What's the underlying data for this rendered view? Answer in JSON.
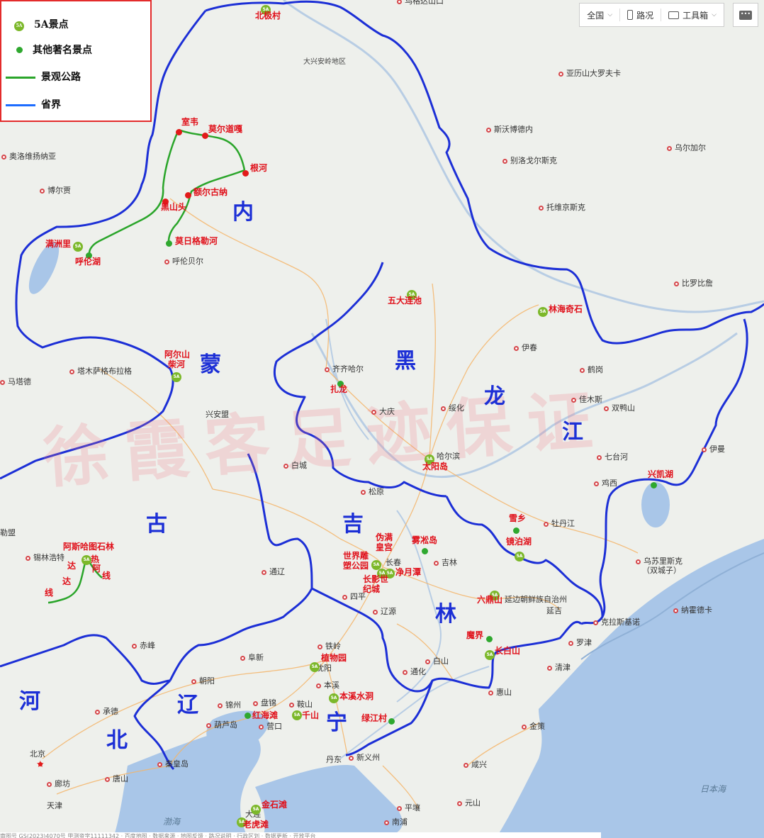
{
  "legend": {
    "items": [
      {
        "label": "5A景点",
        "symbol": "5A"
      },
      {
        "label": "其他著名景点",
        "symbol": "green-dot"
      },
      {
        "label": "景观公路",
        "symbol": "green-line"
      },
      {
        "label": "省界",
        "symbol": "blue-line"
      }
    ],
    "badge_text": "5A"
  },
  "toolbar": {
    "scope": "全国",
    "traffic": "路况",
    "tools": "工具箱"
  },
  "colors": {
    "province_border": "#1c2fd6",
    "scenic_road": "#2aa52a",
    "scenic_text": "#e0101a",
    "sea": "#a9c6e8",
    "land": "#eef0ec"
  },
  "provinces": {
    "nei": "内",
    "meng": "蒙",
    "gu": "古",
    "hei": "黑",
    "long": "龙",
    "jiang": "江",
    "ji": "吉",
    "lin": "林",
    "liao": "辽",
    "ning": "宁",
    "he": "河",
    "bei": "北"
  },
  "scenic": {
    "beijicun": "北极村",
    "shiwei": "室韦",
    "moerdaoga": "莫尔道嘎",
    "genhe": "根河",
    "eerguna": "额尔古纳",
    "heishantou": "黑山头",
    "mangzhouli": "满洲里",
    "hulunhu": "呼伦湖",
    "morigele": "莫日格勒河",
    "wudalianchi": "五大连池",
    "linhaiqishi": "林海奇石",
    "aershan": "阿尔山",
    "chaihe": "柴河",
    "zhalong": "扎龙",
    "taiyangdao": "太阳岛",
    "xingkaihu": "兴凯湖",
    "xuexiang": "雪乡",
    "jingpohu": "镜泊湖",
    "asihatu": "阿斯哈图石林",
    "daretai_1": "达",
    "daretai_2": "热",
    "daretai_3": "阿",
    "daretai_4": "线",
    "daretai_5": "达",
    "daretai_6": "线",
    "weimanhuanggong": "伪满皇宫",
    "shijiediaosu": "世界雕塑公园",
    "changying": "长影世纪城",
    "jingyuetan": "净月潭",
    "wusongdao": "雾凇岛",
    "liudingshan": "六鼎山",
    "mojie": "魔界",
    "changbaishan": "长白山",
    "zhiwuyuan": "植物园",
    "benxishuidong": "本溪水洞",
    "lvjiangcun": "绿江村",
    "honghaitan": "红海滩",
    "qianshan": "千山",
    "jinshitan": "金石滩",
    "laohutan": "老虎滩"
  },
  "cities": {
    "mohe_top": "乌格达山口",
    "daxinganling": "大兴安岭地区",
    "yalishan": "亚历山大罗夫卡",
    "siwobode": "斯沃博德内",
    "wuerjia": "乌尔加尔",
    "bieluoge": "别洛戈尔斯克",
    "tuoweng": "托维京斯克",
    "aoluowei": "奥洛维扬纳亚",
    "boerjia": "博尔贾",
    "hulunbeier": "呼伦贝尔",
    "biluobi": "比罗比詹",
    "yichun": "伊春",
    "hegang": "鹤岗",
    "jiamusi": "佳木斯",
    "shuangyashan": "双鸭山",
    "qiqihaer": "齐齐哈尔",
    "daqing": "大庆",
    "suihua": "绥化",
    "haerbin": "哈尔滨",
    "qitaihe": "七台河",
    "jixi": "鸡西",
    "yiman": "伊曼",
    "tamusa": "塔木萨格布拉格",
    "matade": "马塔德",
    "xinganmeng": "兴安盟",
    "baicheng": "白城",
    "songyuan": "松原",
    "mudanjiang": "牡丹江",
    "wusulisike": "乌苏里斯克",
    "shuangchengzi": "（双城子）",
    "xilinhaote": "锡林浩特",
    "tongliao": "通辽",
    "changchun": "长春",
    "jilin": "吉林",
    "siping": "四平",
    "liaoyuan": "辽源",
    "yanbian": "延边朝鲜族自治州",
    "yanji": "延吉",
    "nahuodeka": "纳霍德卡",
    "kelasi": "克拉斯基诺",
    "luojin": "罗津",
    "qingjin": "清津",
    "chifeng": "赤峰",
    "fuxin": "阜新",
    "tieling": "铁岭",
    "shenyang": "沈阳",
    "benxi": "本溪",
    "tonghua": "通化",
    "baishan": "白山",
    "huishan": "惠山",
    "chaoyang": "朝阳",
    "jinzhou": "锦州",
    "panjin": "盘锦",
    "anshan": "鞍山",
    "chengde": "承德",
    "huludao": "葫芦岛",
    "yingkou": "营口",
    "jince": "金策",
    "beijing": "北京",
    "qinhuangdao": "秦皇岛",
    "dandong": "丹东",
    "xinyizhou": "新义州",
    "xianxing": "咸兴",
    "langfang": "廊坊",
    "tangshan": "唐山",
    "tianjin": "天津",
    "dalian": "大连",
    "pingrang": "平壤",
    "yuanshan": "元山",
    "nanpu": "南浦",
    "bohai": "渤海",
    "ribenhai": "日本海",
    "mengu": "勒盟"
  },
  "watermark": "徐霞客足迹保证",
  "bottom_text": "审图号 GS(2023)4070号  甲测资字11111342 · 百度地图  · 数据来源  · 地图反馈  · 路况说明  · 行政区划  ·  数据更新  · 开放平台"
}
